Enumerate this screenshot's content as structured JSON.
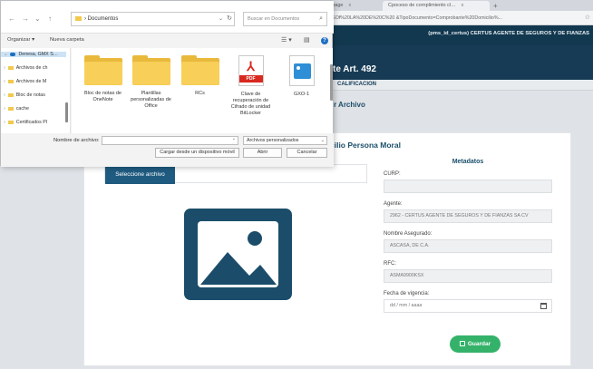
{
  "browser": {
    "tabs": [
      {
        "label": "... gapage",
        "close": "x"
      },
      {
        "label": "Cpoceso de cornplimiento cl…",
        "close": "x"
      }
    ],
    "new_tab": "+",
    "url": "...ncSodal=ASOf%20LA%20DE%20C%20 &TipoDocumento=Comprobante%20Domicilio%...",
    "top_right_text": "(pms_id_certus) CERTUS AGENTE DE SEGUROS Y DE FIANZAS",
    "hero_title": "te Art. 492",
    "subnav": "CALIFICACION",
    "subheading": "r Archivo"
  },
  "card": {
    "title": "cilio Persona Moral",
    "select_file_button": "Seleccione archivo",
    "metadata": {
      "title": "Metadatos",
      "fields": [
        {
          "label": "CURP:",
          "value": ""
        },
        {
          "label": "Agente:",
          "value": "2962 - CERTUS AGENTE DE SEGUROS Y DE FIANZAS SA CV"
        },
        {
          "label": "Nombre Asegurado:",
          "value": "ASCASA, DE C.A."
        },
        {
          "label": "RFC:",
          "value": "ASMA9900KSX"
        },
        {
          "label": "Fecha de vigencia:",
          "value": "dd / mm / aaaa"
        }
      ]
    },
    "save_button": "Guardar"
  },
  "dialog": {
    "nav": {
      "back": "←",
      "forward": "→",
      "recent": "⌄",
      "up": "↑"
    },
    "address": "Documentos",
    "address_prefix": "› ",
    "address_chevron": "⌄",
    "refresh": "↻",
    "search_placeholder": "Buscar en Documentos",
    "search_icon": "⌕",
    "toolbar": {
      "organize": "Organizar ▾",
      "new_folder": "Nueva carpeta",
      "view": "☰ ▾",
      "pane": "▤"
    },
    "help": "?",
    "nav_items": [
      {
        "label": "Denesa, GMX S…",
        "chev": "⌄"
      },
      {
        "label": "Archivos de ch",
        "chev": "›"
      },
      {
        "label": "Archivos de M",
        "chev": "›"
      },
      {
        "label": "Bloc de notas",
        "chev": "›"
      },
      {
        "label": "cache",
        "chev": "›"
      },
      {
        "label": "Certificados PI",
        "chev": "›"
      }
    ],
    "files": [
      {
        "label": "Bloc de notas de OneNote",
        "kind": "folder"
      },
      {
        "label": "Plantillas personalizadas de Office",
        "kind": "folder"
      },
      {
        "label": "RCs",
        "kind": "folder"
      },
      {
        "label": "Clave de recuperación de Cifrado de unidad BitLocker",
        "kind": "pdf",
        "badge": "PDF",
        "glyph": "⅄"
      },
      {
        "label": "GXO-1",
        "kind": "image"
      }
    ],
    "filename_label": "Nombre de archivo:",
    "filename_value": "",
    "dropdown_glyph": "⌄",
    "filetype": "Archivos personalizados",
    "load_from_device": "Cargar desde un dispositivo móvil",
    "open": "Abrir",
    "cancel": "Cancelar"
  },
  "colors": {
    "header_navy": "#12384f",
    "hero_navy": "#173b55",
    "accent_blue": "#1f5b80",
    "save_green": "#34b26a",
    "folder_yellow": "#f7cf59",
    "pdf_red": "#d8281f"
  }
}
